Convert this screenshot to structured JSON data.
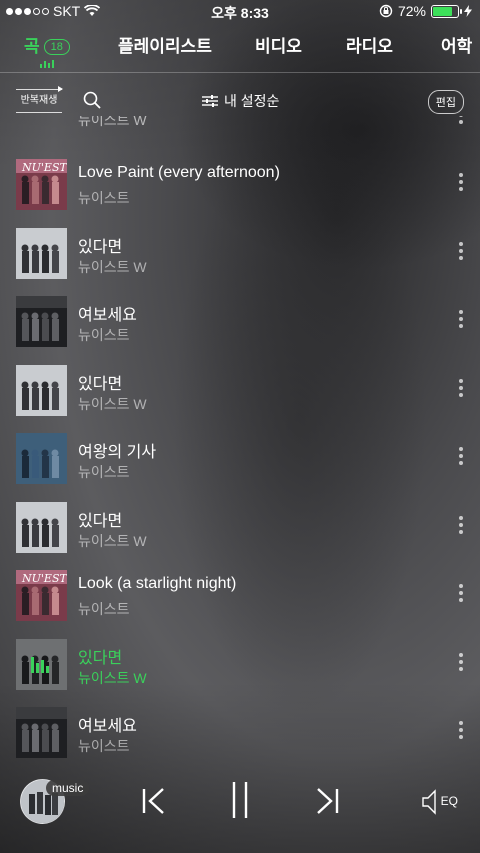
{
  "status": {
    "carrier": "SKT",
    "time": "오후 8:33",
    "battery": "72%",
    "battery_level": 0.72
  },
  "tabs": [
    {
      "label": "곡",
      "badge": "18",
      "active": true
    },
    {
      "label": "플레이리스트"
    },
    {
      "label": "비디오"
    },
    {
      "label": "라디오"
    },
    {
      "label": "어학"
    }
  ],
  "toolbar": {
    "repeat_label": "반복재생",
    "sort_label": "내 설정순",
    "edit_label": "편집"
  },
  "partial_row": {
    "artist": "뉴이스트 W"
  },
  "songs": [
    {
      "title": "Love Paint (every afternoon)",
      "artist": "뉴이스트",
      "art": "nuest-pink"
    },
    {
      "title": "있다면",
      "artist": "뉴이스트 W",
      "art": "nuest-w-grey"
    },
    {
      "title": "여보세요",
      "artist": "뉴이스트",
      "art": "nuest-dark"
    },
    {
      "title": "있다면",
      "artist": "뉴이스트 W",
      "art": "nuest-w-grey"
    },
    {
      "title": "여왕의 기사",
      "artist": "뉴이스트",
      "art": "nuest-blue"
    },
    {
      "title": "있다면",
      "artist": "뉴이스트 W",
      "art": "nuest-w-grey"
    },
    {
      "title": "Look (a starlight night)",
      "artist": "뉴이스트",
      "art": "nuest-pink"
    },
    {
      "title": "있다면",
      "artist": "뉴이스트 W",
      "art": "nuest-w-grey",
      "playing": true
    },
    {
      "title": "여보세요",
      "artist": "뉴이스트",
      "art": "nuest-dark"
    }
  ],
  "player": {
    "music_label": "music",
    "eq_label": "EQ"
  },
  "colors": {
    "accent": "#3ad15b"
  }
}
